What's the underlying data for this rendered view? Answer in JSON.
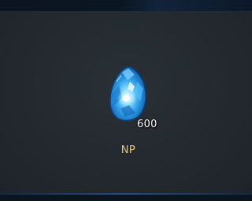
{
  "reward": {
    "icon": "blue-crystal-icon",
    "count": "600",
    "name": "NP"
  },
  "colors": {
    "panel": "#262c32",
    "name_text": "#e9c46a",
    "crystal": "#3aa8ff",
    "accent_line": "#1f4f86"
  }
}
